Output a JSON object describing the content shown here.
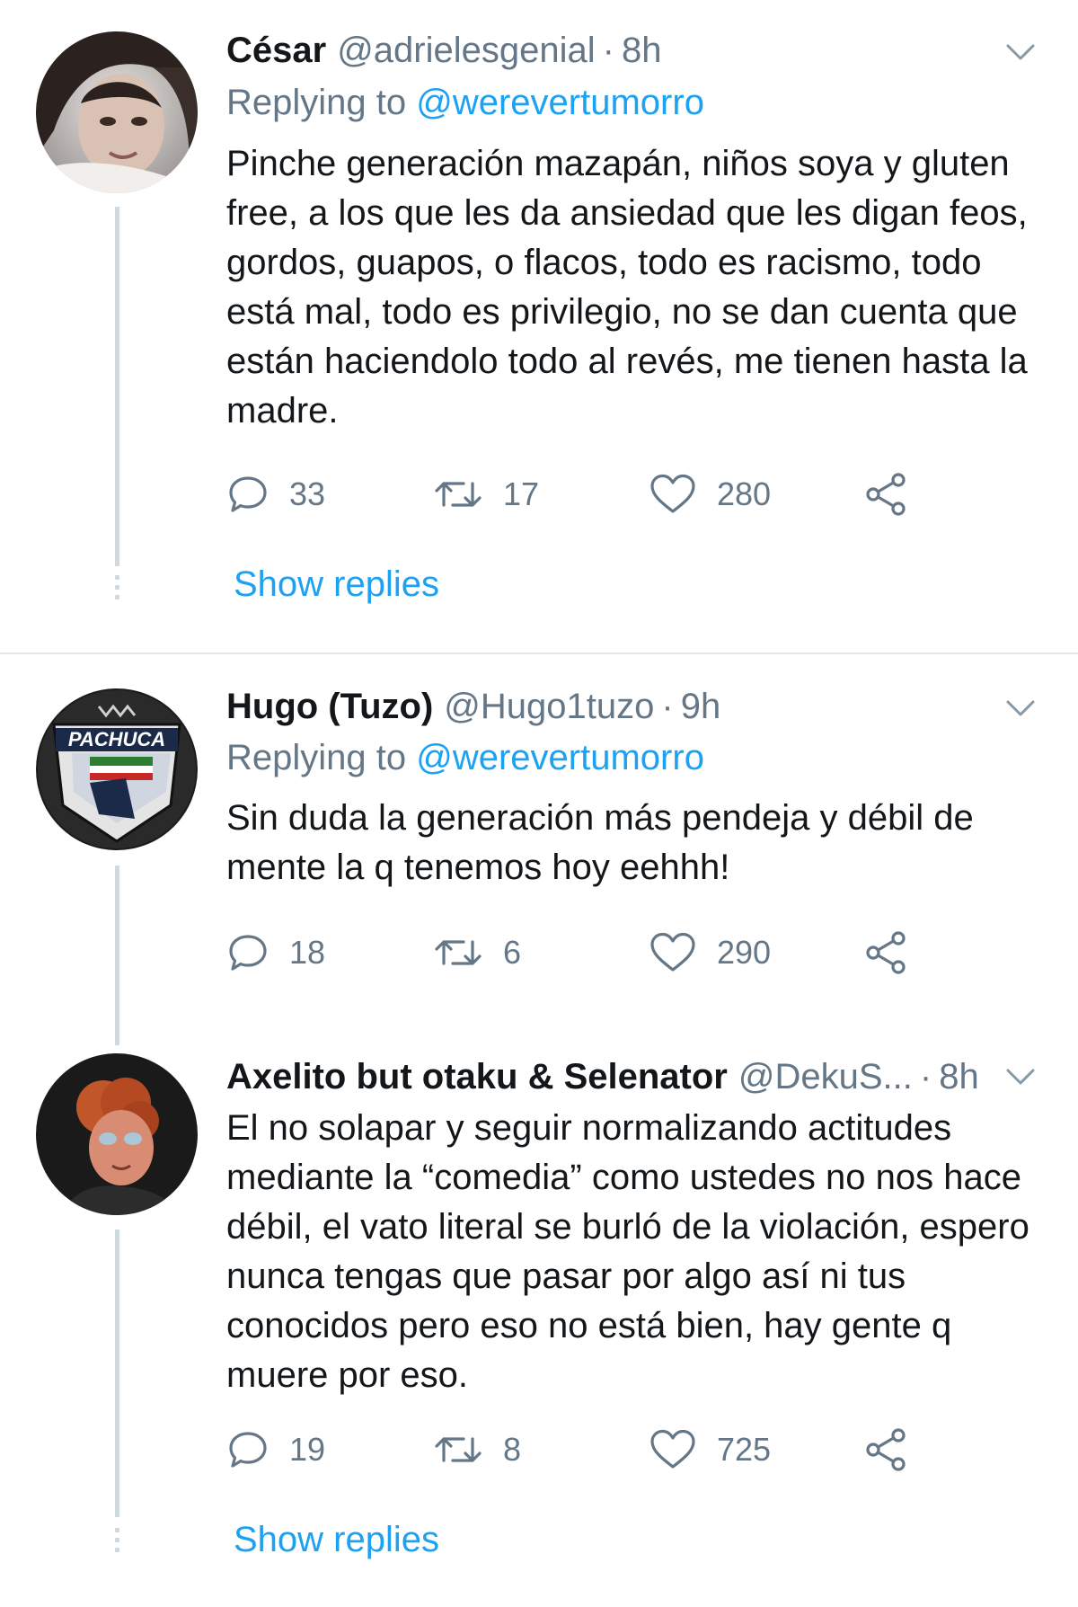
{
  "tweets": [
    {
      "name": "César",
      "handle": "@adrielesgenial",
      "separator": "·",
      "time": "8h",
      "replying_prefix": "Replying to",
      "replying_to": "@werevertumorro",
      "text": "Pinche generación mazapán, niños soya y gluten free, a los que les da ansiedad que les digan feos, gordos, guapos, o flacos, todo es racismo, todo está mal, todo es privilegio, no se dan cuenta que están haciendolo todo al revés, me tienen hasta la madre.",
      "replies": "33",
      "retweets": "17",
      "likes": "280",
      "show_replies": "Show replies"
    },
    {
      "name": "Hugo (Tuzo)",
      "handle": "@Hugo1tuzo",
      "separator": "·",
      "time": "9h",
      "replying_prefix": "Replying to",
      "replying_to": "@werevertumorro",
      "text": "Sin duda la generación más pendeja y débil  de mente la q tenemos hoy eehhh!",
      "replies": "18",
      "retweets": "6",
      "likes": "290"
    },
    {
      "name": "Axelito but otaku & Selenator",
      "handle": "@DekuS...",
      "separator": "·",
      "time": "8h",
      "text": "El no solapar y seguir normalizando actitudes mediante la “comedia” como ustedes no nos hace débil, el vato literal se burló de la violación, espero nunca tengas que pasar por algo así ni tus conocidos pero eso no está bien, hay gente q muere por eso.",
      "replies": "19",
      "retweets": "8",
      "likes": "725",
      "show_replies": "Show replies"
    }
  ],
  "colors": {
    "link": "#1da1f2",
    "secondary": "#657786",
    "thread_line": "#cfd9de",
    "text": "#14171a"
  },
  "icons": [
    "reply-icon",
    "retweet-icon",
    "like-icon",
    "share-icon",
    "chevron-down-icon"
  ]
}
